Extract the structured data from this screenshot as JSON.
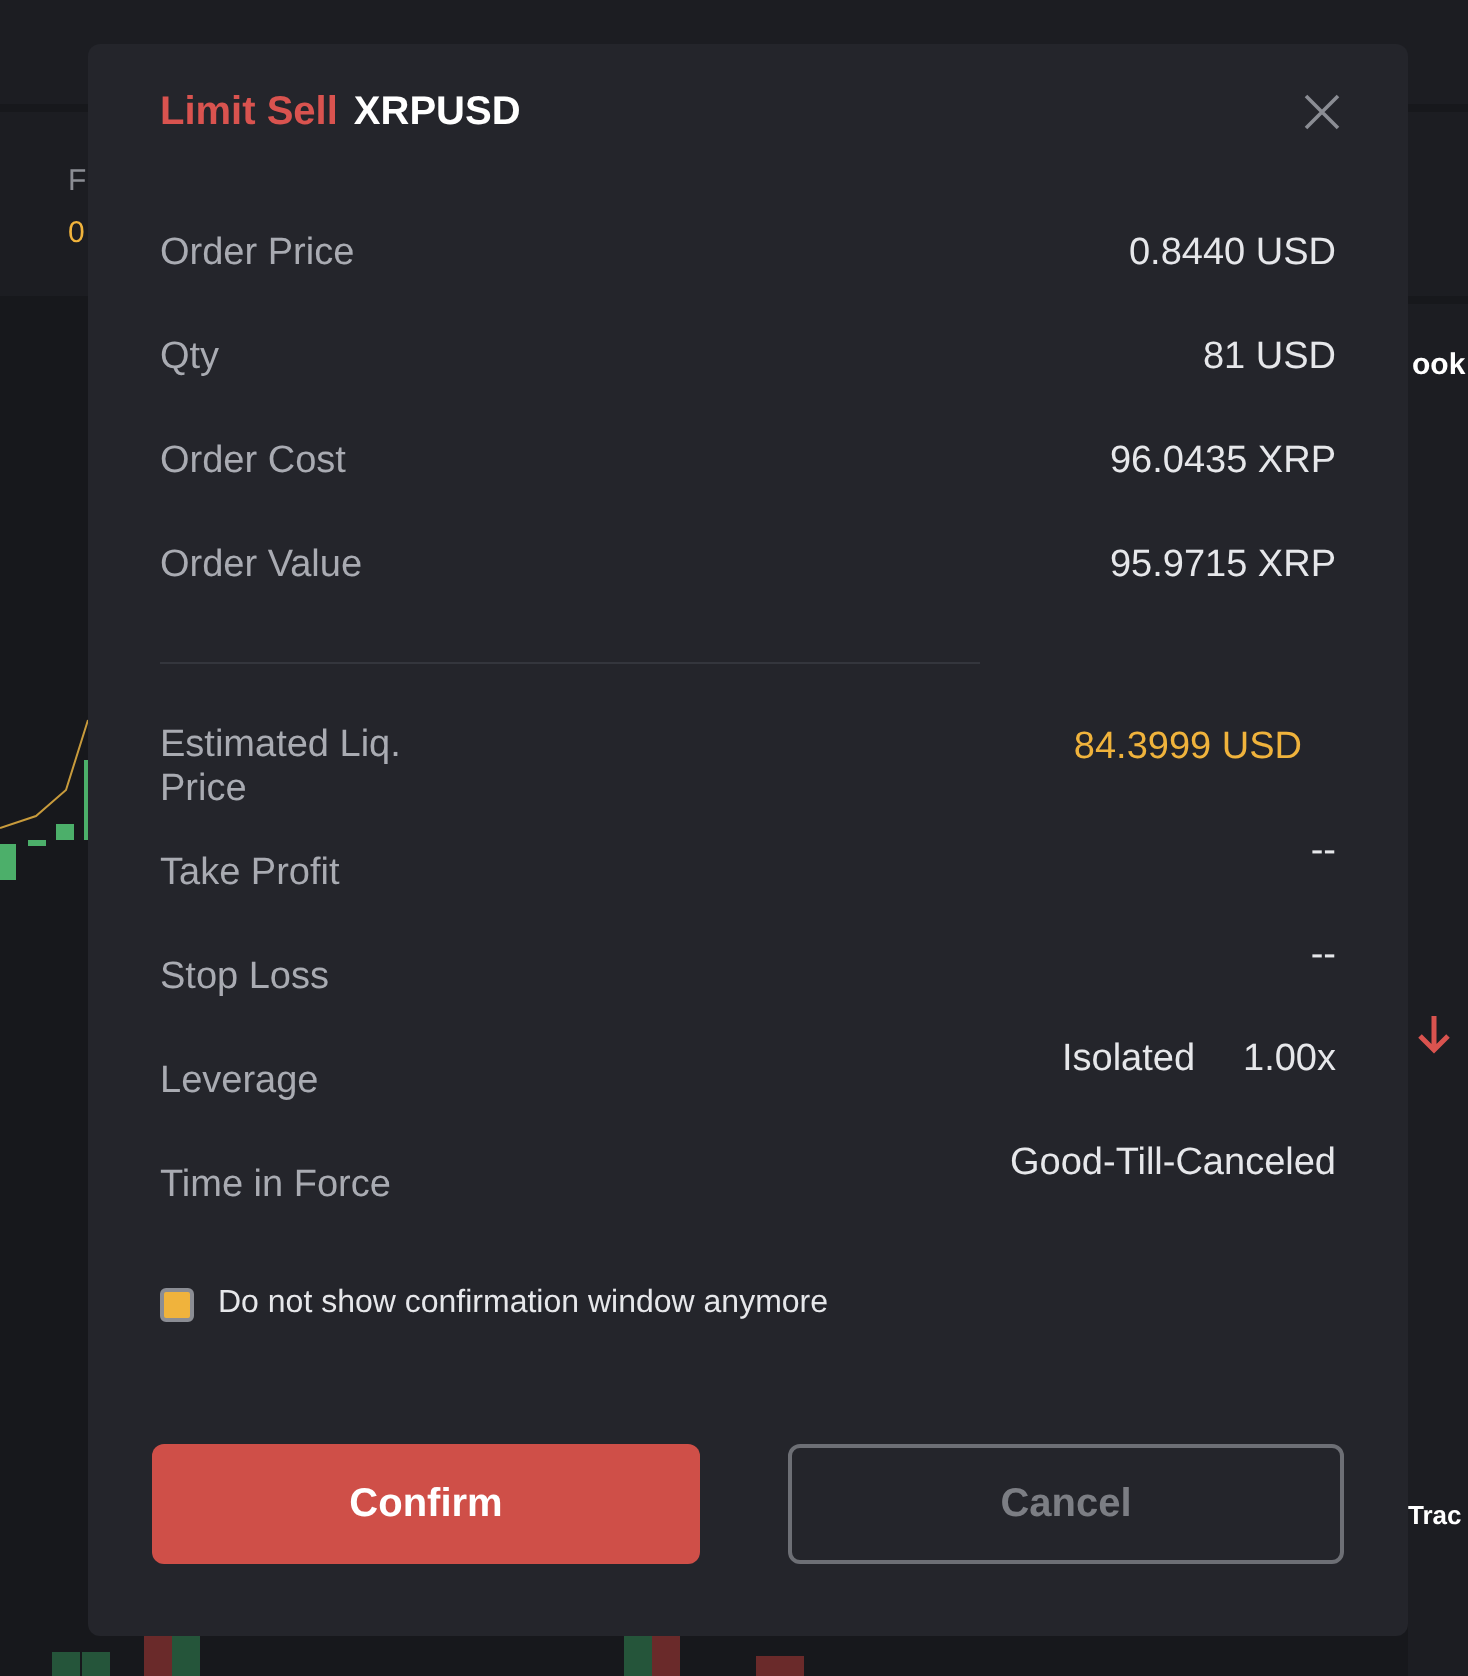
{
  "background": {
    "fragments": [
      {
        "kind": "label",
        "text": "F"
      },
      {
        "kind": "price",
        "text": "0"
      },
      {
        "kind": "heading",
        "text": "ook"
      },
      {
        "kind": "heading",
        "text": "Trac"
      }
    ]
  },
  "dialog": {
    "title": {
      "action": "Limit Sell",
      "symbol": "XRPUSD"
    },
    "summary": [
      {
        "label": "Order Price",
        "value": "0.8440 USD"
      },
      {
        "label": "Qty",
        "value": "81 USD"
      },
      {
        "label": "Order Cost",
        "value": "96.0435 XRP"
      },
      {
        "label": "Order Value",
        "value": "95.9715 XRP"
      }
    ],
    "details": [
      {
        "label": "Estimated Liq. Price",
        "values": [
          "84.3999 USD"
        ],
        "highlight": true
      },
      {
        "label": "Take Profit",
        "values": [
          "--"
        ],
        "highlight": false
      },
      {
        "label": "Stop Loss",
        "values": [
          "--"
        ],
        "highlight": false
      },
      {
        "label": "Leverage",
        "values": [
          "Isolated",
          "1.00x"
        ],
        "highlight": false
      },
      {
        "label": "Time in Force",
        "values": [
          "Good-Till-Canceled"
        ],
        "highlight": false
      }
    ],
    "checkbox": {
      "label": "Do not show confirmation window anymore",
      "checked": true
    },
    "buttons": [
      {
        "kind": "primary",
        "label": "Confirm"
      },
      {
        "kind": "secondary",
        "label": "Cancel"
      }
    ]
  }
}
